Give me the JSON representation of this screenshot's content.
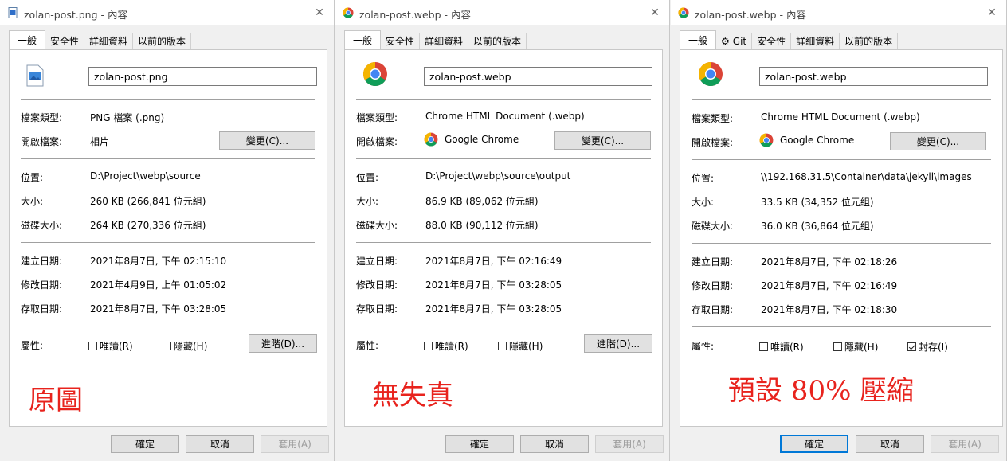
{
  "windows": [
    {
      "title": "zolan-post.png - 內容",
      "title_icon": "png-file-icon",
      "tabs": [
        "一般",
        "安全性",
        "詳細資料",
        "以前的版本"
      ],
      "filename": "zolan-post.png",
      "labels": {
        "type": "檔案類型:",
        "opens_with": "開啟檔案:",
        "location": "位置:",
        "size": "大小:",
        "disk_size": "磁碟大小:",
        "created": "建立日期:",
        "modified": "修改日期:",
        "accessed": "存取日期:",
        "attributes": "屬性:"
      },
      "file_type": "PNG 檔案 (.png)",
      "opens_with": "相片",
      "location": "D:\\Project\\webp\\source",
      "size": "260 KB (266,841 位元組)",
      "disk_size": "264 KB (270,336 位元組)",
      "created": "2021年8月7日, 下午 02:15:10",
      "modified": "2021年4月9日, 上午 01:05:02",
      "accessed": "2021年8月7日, 下午 03:28:05",
      "change_button": "變更(C)...",
      "readonly_label": "唯讀(R)",
      "hidden_label": "隱藏(H)",
      "advanced_button": "進階(D)...",
      "note": "原圖",
      "ok": "確定",
      "cancel": "取消",
      "apply": "套用(A)"
    },
    {
      "title": "zolan-post.webp - 內容",
      "title_icon": "chrome-icon",
      "tabs": [
        "一般",
        "安全性",
        "詳細資料",
        "以前的版本"
      ],
      "filename": "zolan-post.webp",
      "labels": {
        "type": "檔案類型:",
        "opens_with": "開啟檔案:",
        "location": "位置:",
        "size": "大小:",
        "disk_size": "磁碟大小:",
        "created": "建立日期:",
        "modified": "修改日期:",
        "accessed": "存取日期:",
        "attributes": "屬性:"
      },
      "file_type": "Chrome HTML Document (.webp)",
      "opens_with": "Google Chrome",
      "location": "D:\\Project\\webp\\source\\output",
      "size": "86.9 KB (89,062 位元組)",
      "disk_size": "88.0 KB (90,112 位元組)",
      "created": "2021年8月7日, 下午 02:16:49",
      "modified": "2021年8月7日, 下午 03:28:05",
      "accessed": "2021年8月7日, 下午 03:28:05",
      "change_button": "變更(C)...",
      "readonly_label": "唯讀(R)",
      "hidden_label": "隱藏(H)",
      "advanced_button": "進階(D)...",
      "note": "無失真",
      "ok": "確定",
      "cancel": "取消",
      "apply": "套用(A)"
    },
    {
      "title": "zolan-post.webp - 內容",
      "title_icon": "chrome-icon",
      "tabs": [
        "一般",
        "Git",
        "安全性",
        "詳細資料",
        "以前的版本"
      ],
      "filename": "zolan-post.webp",
      "labels": {
        "type": "檔案類型:",
        "opens_with": "開啟檔案:",
        "location": "位置:",
        "size": "大小:",
        "disk_size": "磁碟大小:",
        "created": "建立日期:",
        "modified": "修改日期:",
        "accessed": "存取日期:",
        "attributes": "屬性:"
      },
      "file_type": "Chrome HTML Document (.webp)",
      "opens_with": "Google Chrome",
      "location": "\\\\192.168.31.5\\Container\\data\\jekyll\\images",
      "size": "33.5 KB (34,352 位元組)",
      "disk_size": "36.0 KB (36,864 位元組)",
      "created": "2021年8月7日, 下午 02:18:26",
      "modified": "2021年8月7日, 下午 02:16:49",
      "accessed": "2021年8月7日, 下午 02:18:30",
      "change_button": "變更(C)...",
      "readonly_label": "唯讀(R)",
      "hidden_label": "隱藏(H)",
      "archive_label": "封存(I)",
      "note": "預設 80% 壓縮",
      "ok": "確定",
      "cancel": "取消",
      "apply": "套用(A)"
    }
  ],
  "colors": {
    "note": "#e8231d",
    "default_button_border": "#0078d7"
  }
}
